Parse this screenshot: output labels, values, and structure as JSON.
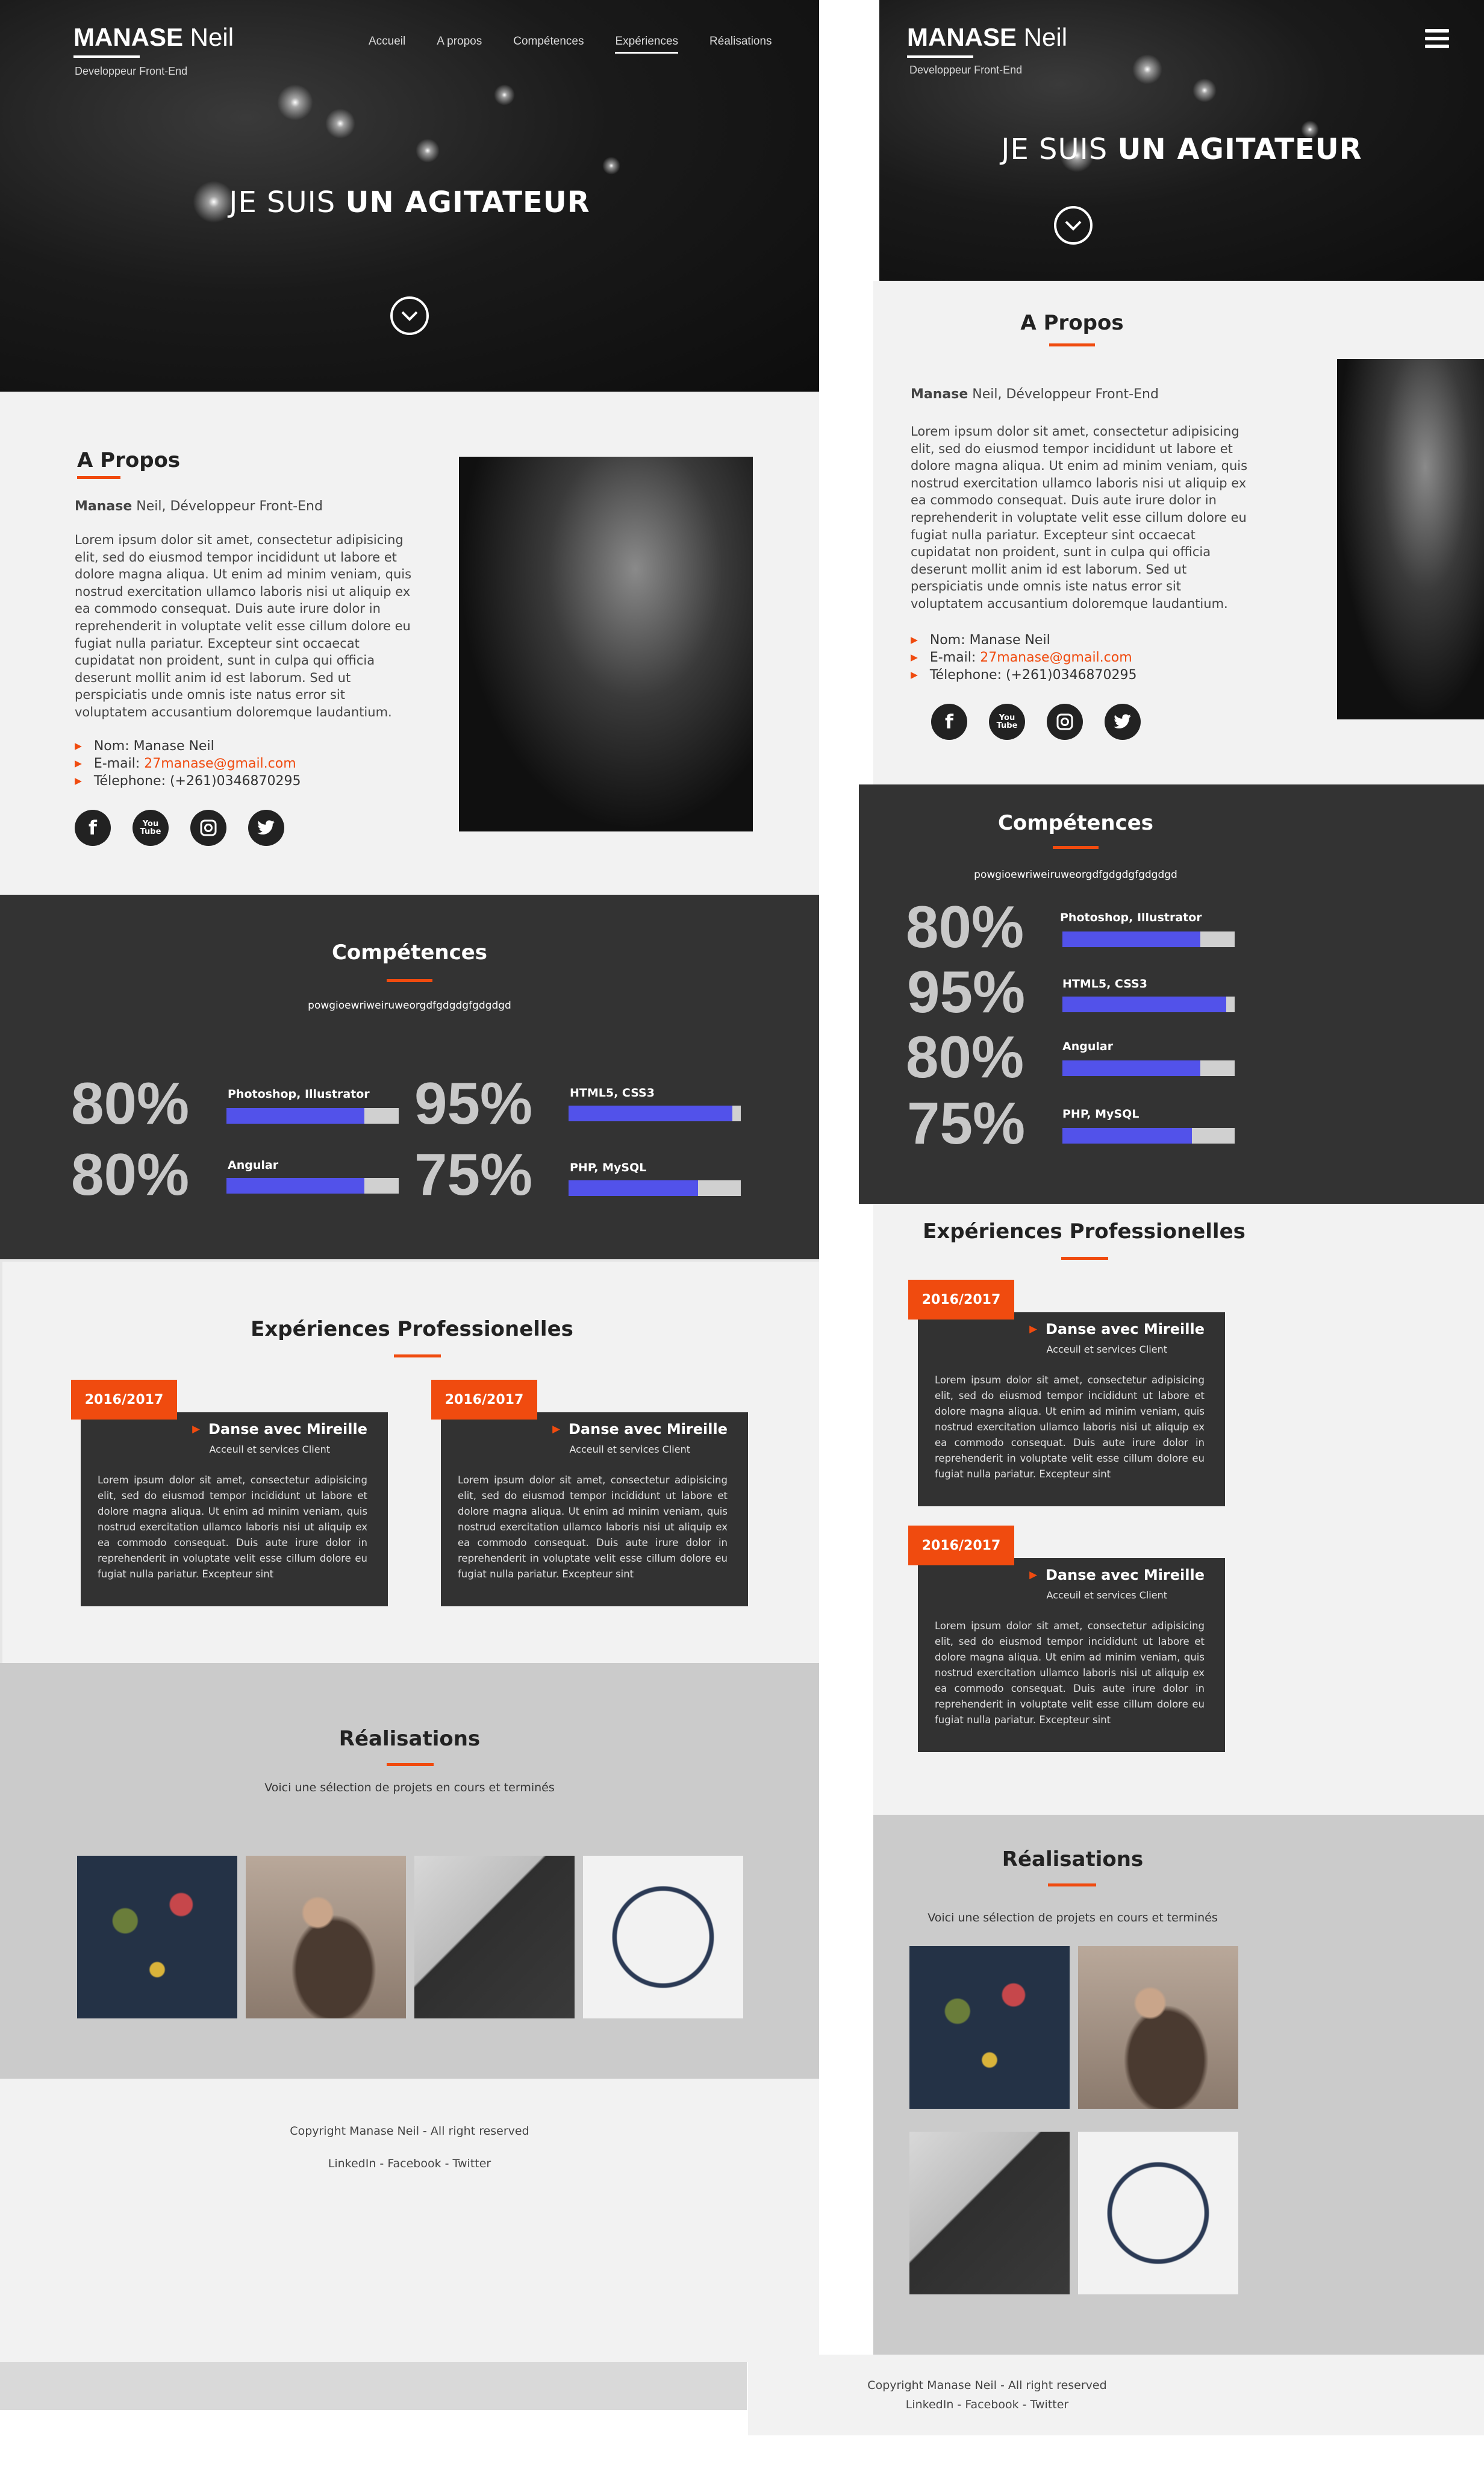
{
  "brand": {
    "name_bold": "MANASE",
    "name_rest": " Neil",
    "subtitle": "Developpeur Front-End"
  },
  "nav": {
    "items": [
      "Accueil",
      "A propos",
      "Compétences",
      "Expériences",
      "Réalisations"
    ],
    "active": "Expériences"
  },
  "hero": {
    "title_light": "JE SUIS ",
    "title_bold": "UN AGITATEUR"
  },
  "about": {
    "heading": "A Propos",
    "intro_bold": "Manase",
    "intro_rest": " Neil, Développeur Front-End",
    "paragraph": "Lorem ipsum dolor sit amet, consectetur adipisicing elit, sed do eiusmod tempor incididunt ut labore et dolore magna aliqua. Ut enim ad minim veniam, quis nostrud exercitation ullamco laboris nisi ut aliquip ex ea commodo consequat. Duis aute irure dolor in reprehenderit in voluptate velit esse cillum dolore eu fugiat nulla pariatur. Excepteur sint occaecat cupidatat non proident, sunt in culpa qui officia deserunt mollit anim id est laborum. Sed ut perspiciatis unde omnis iste natus error sit voluptatem accusantium doloremque laudantium.",
    "name_label": "Nom: Manase Neil",
    "email_label": "E-mail: ",
    "email": "27manase@gmail.com",
    "phone_label": "Télephone: (+261)0346870295",
    "social": [
      "facebook-icon",
      "youtube-icon",
      "instagram-icon",
      "twitter-icon"
    ],
    "youtube_text": "You Tube"
  },
  "skills": {
    "heading": "Compétences",
    "subtitle": "powgioewriweiruweorgdfgdgdgfgdgdgd",
    "items": [
      {
        "pct": "80%",
        "name": "Photoshop, Illustrator",
        "level": 0.8
      },
      {
        "pct": "95%",
        "name": "HTML5, CSS3",
        "level": 0.95
      },
      {
        "pct": "80%",
        "name": "Angular",
        "level": 0.8
      },
      {
        "pct": "75%",
        "name": "PHP, MySQL",
        "level": 0.75
      }
    ]
  },
  "experience": {
    "heading": "Expériences Professionelles",
    "items": [
      {
        "year": "2016/2017",
        "title": "Danse avec Mireille",
        "role": "Acceuil et services Client",
        "text": "Lorem ipsum dolor sit amet, consectetur adipisicing elit, sed do eiusmod tempor incididunt ut labore et dolore magna aliqua. Ut enim ad minim veniam, quis nostrud exercitation ullamco laboris nisi ut aliquip ex ea commodo consequat. Duis aute irure dolor in reprehenderit in voluptate velit esse cillum dolore eu fugiat nulla pariatur. Excepteur sint"
      },
      {
        "year": "2016/2017",
        "title": "Danse avec Mireille",
        "role": "Acceuil et services Client",
        "text": "Lorem ipsum dolor sit amet, consectetur adipisicing elit, sed do eiusmod tempor incididunt ut labore et dolore magna aliqua. Ut enim ad minim veniam, quis nostrud exercitation ullamco laboris nisi ut aliquip ex ea commodo consequat. Duis aute irure dolor in reprehenderit in voluptate velit esse cillum dolore eu fugiat nulla pariatur. Excepteur sint"
      }
    ]
  },
  "works": {
    "heading": "Réalisations",
    "subtitle": "Voici une sélection de projets en cours et terminés"
  },
  "footer": {
    "copyright": "Copyright Manase Neil - All right reserved",
    "links": [
      "LinkedIn",
      "Facebook",
      "Twitter"
    ],
    "sep": " - "
  },
  "colors": {
    "accent": "#f04b0f",
    "bar": "#5252ea",
    "dark": "#333333",
    "light": "#f2f2f2",
    "grey": "#cbcbcb"
  }
}
